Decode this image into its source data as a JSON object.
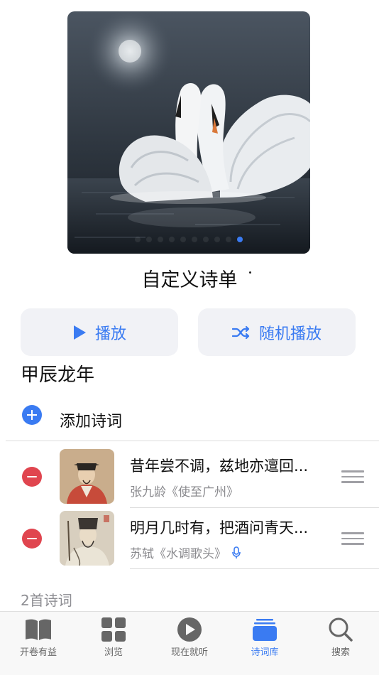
{
  "cover": {
    "image": "swans-on-water",
    "page_count": 10,
    "active_page": 9
  },
  "playlist": {
    "title": "自定义诗单"
  },
  "actions": {
    "play_label": "播放",
    "shuffle_label": "随机播放"
  },
  "section": {
    "title": "甲辰龙年"
  },
  "add": {
    "label": "添加诗词"
  },
  "poems": [
    {
      "line": "昔年尝不调，兹地亦邅回...",
      "author_work": "张九龄《使至广州》",
      "has_audio": false
    },
    {
      "line": "明月几时有，把酒问青天...",
      "author_work": "苏轼《水调歌头》",
      "has_audio": true
    }
  ],
  "count_label": "2首诗词",
  "tabs": [
    {
      "label": "开卷有益",
      "icon": "book-icon",
      "active": false
    },
    {
      "label": "浏览",
      "icon": "grid-icon",
      "active": false
    },
    {
      "label": "现在就听",
      "icon": "play-circle-icon",
      "active": false
    },
    {
      "label": "诗词库",
      "icon": "library-icon",
      "active": true
    },
    {
      "label": "搜索",
      "icon": "search-icon",
      "active": false
    }
  ],
  "colors": {
    "accent": "#3a7bf2",
    "remove": "#e0454f",
    "secondary_text": "#8a8a8e"
  }
}
